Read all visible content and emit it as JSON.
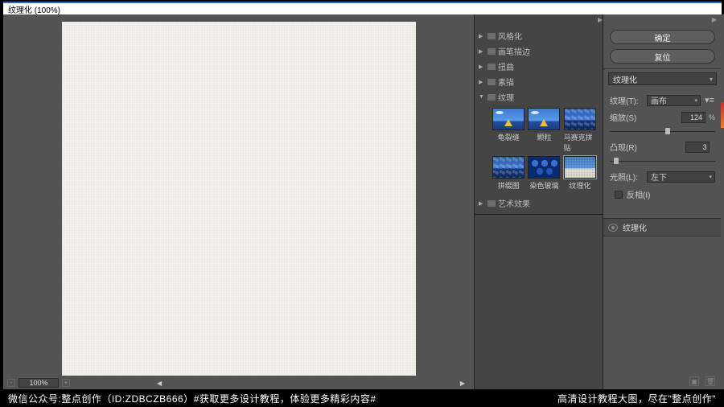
{
  "window": {
    "title": "纹理化 (100%)"
  },
  "preview": {
    "zoom": "100%"
  },
  "filter_tree": {
    "groups": [
      {
        "label": "风格化",
        "expanded": false
      },
      {
        "label": "画笔描边",
        "expanded": false
      },
      {
        "label": "扭曲",
        "expanded": false
      },
      {
        "label": "素描",
        "expanded": false
      },
      {
        "label": "纹理",
        "expanded": true
      },
      {
        "label": "艺术效果",
        "expanded": false
      }
    ],
    "thumbs": [
      {
        "label": "龟裂缝"
      },
      {
        "label": "颗粒"
      },
      {
        "label": "马赛克拼贴"
      },
      {
        "label": "拼缀图"
      },
      {
        "label": "染色玻璃"
      },
      {
        "label": "纹理化"
      }
    ]
  },
  "right": {
    "ok": "确定",
    "cancel": "复位",
    "filter_select": "纹理化",
    "params": {
      "texture_label": "纹理(T):",
      "texture_value": "画布",
      "scale_label": "缩放(S)",
      "scale_value": "124",
      "scale_unit": "%",
      "relief_label": "凸现(R)",
      "relief_value": "3",
      "light_label": "光照(L):",
      "light_value": "左下",
      "invert_label": "反相(I)"
    }
  },
  "layers": {
    "item": "纹理化"
  },
  "footer": {
    "left": "微信公众号:整点创作（ID:ZDBCZB666）#获取更多设计教程，体验更多精彩内容#",
    "right": "高清设计教程大图，尽在\"整点创作\""
  }
}
